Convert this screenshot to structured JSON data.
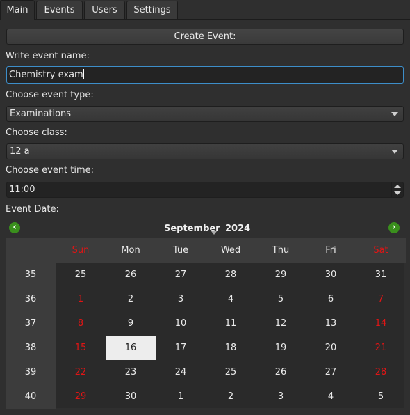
{
  "tabs": [
    {
      "label": "Main",
      "active": true
    },
    {
      "label": "Events",
      "active": false
    },
    {
      "label": "Users",
      "active": false
    },
    {
      "label": "Settings",
      "active": false
    }
  ],
  "form": {
    "create_button": "Create Event:",
    "name_label": "Write event name:",
    "name_value": "Chemistry exam",
    "type_label": "Choose event type:",
    "type_value": "Examinations",
    "class_label": "Choose class:",
    "class_value": "12 a",
    "time_label": "Choose event time:",
    "time_value": "11:00",
    "date_label": "Event Date:"
  },
  "calendar": {
    "month": "September",
    "year": "2024",
    "prev_icon": "arrow-left-icon",
    "next_icon": "arrow-right-icon",
    "weekdays": [
      "Sun",
      "Mon",
      "Tue",
      "Wed",
      "Thu",
      "Fri",
      "Sat"
    ],
    "weeks": [
      "35",
      "36",
      "37",
      "38",
      "39",
      "40"
    ],
    "rows": [
      [
        "25",
        "26",
        "27",
        "28",
        "29",
        "30",
        "31"
      ],
      [
        "1",
        "2",
        "3",
        "4",
        "5",
        "6",
        "7"
      ],
      [
        "8",
        "9",
        "10",
        "11",
        "12",
        "13",
        "14"
      ],
      [
        "15",
        "16",
        "17",
        "18",
        "19",
        "20",
        "21"
      ],
      [
        "22",
        "23",
        "24",
        "25",
        "26",
        "27",
        "28"
      ],
      [
        "29",
        "30",
        "1",
        "2",
        "3",
        "4",
        "5"
      ]
    ],
    "selected": "16",
    "weekend_color": "#e01515",
    "nav_color": "#3a8f1d"
  }
}
